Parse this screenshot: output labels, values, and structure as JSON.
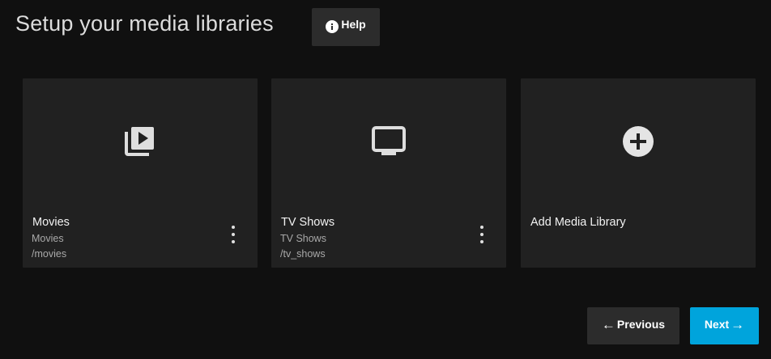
{
  "header": {
    "title": "Setup your media libraries",
    "help_label": "Help",
    "help_icon": "info-circle-icon"
  },
  "libraries": [
    {
      "name": "Movies",
      "type": "Movies",
      "path": "/movies",
      "icon": "video-library-icon"
    },
    {
      "name": "TV Shows",
      "type": "TV Shows",
      "path": "/tv_shows",
      "icon": "tv-icon"
    }
  ],
  "add_card": {
    "label": "Add Media Library",
    "icon": "add-circle-icon"
  },
  "footer": {
    "previous_label": "Previous",
    "next_label": "Next",
    "previous_icon": "arrow-left-icon",
    "next_icon": "arrow-right-icon"
  },
  "colors": {
    "background": "#101010",
    "card": "#212121",
    "secondary_button": "#2c2c2c",
    "accent": "#00a4dc"
  }
}
